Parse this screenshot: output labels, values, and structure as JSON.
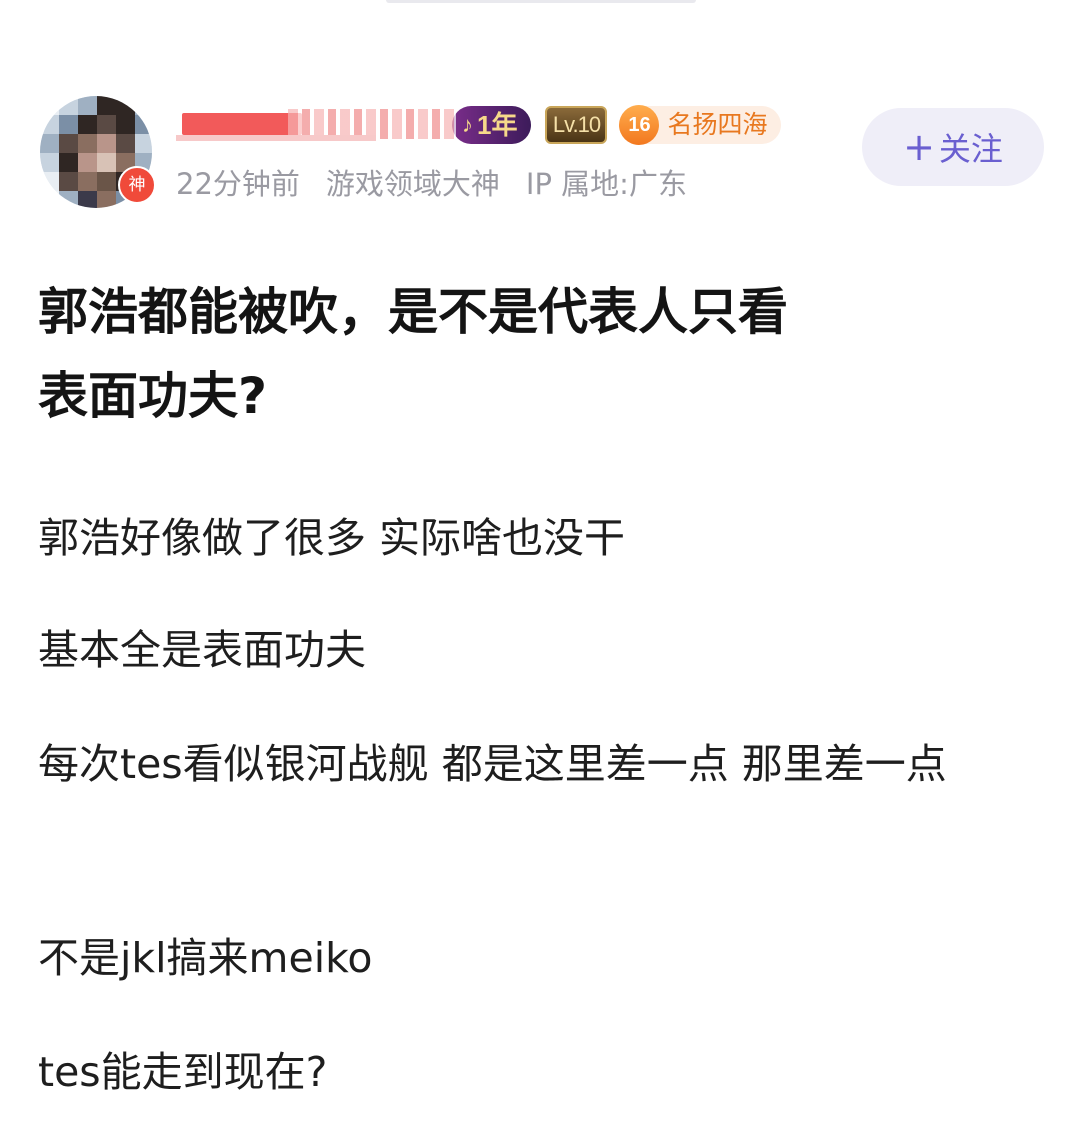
{
  "header": {
    "avatar_badge": "神",
    "badges": {
      "year_icon": "music-note-icon",
      "year": "1年",
      "level": "Lv.10",
      "rank_number": "16",
      "rank_title": "名扬四海"
    },
    "meta": {
      "time": "22分钟前",
      "role": "游戏领域大神",
      "ip": "IP 属地:广东"
    },
    "follow": {
      "icon": "plus-icon",
      "label": "关注"
    }
  },
  "post": {
    "title_lines": [
      "郭浩都能被吹，是不是代表人只看",
      "表面功夫?"
    ],
    "paragraphs": [
      "郭浩好像做了很多 实际啥也没干",
      "基本全是表面功夫",
      "每次tes看似银河战舰 都是这里差一点 那里差一点",
      "不是jkl搞来meiko",
      "tes能走到现在?"
    ]
  },
  "colors": {
    "accent": "#6a5fd0",
    "follow_bg": "#efeef8",
    "meta_text": "#9a9aa2",
    "rank_orange": "#e8781f",
    "god_red": "#f04a3a"
  }
}
